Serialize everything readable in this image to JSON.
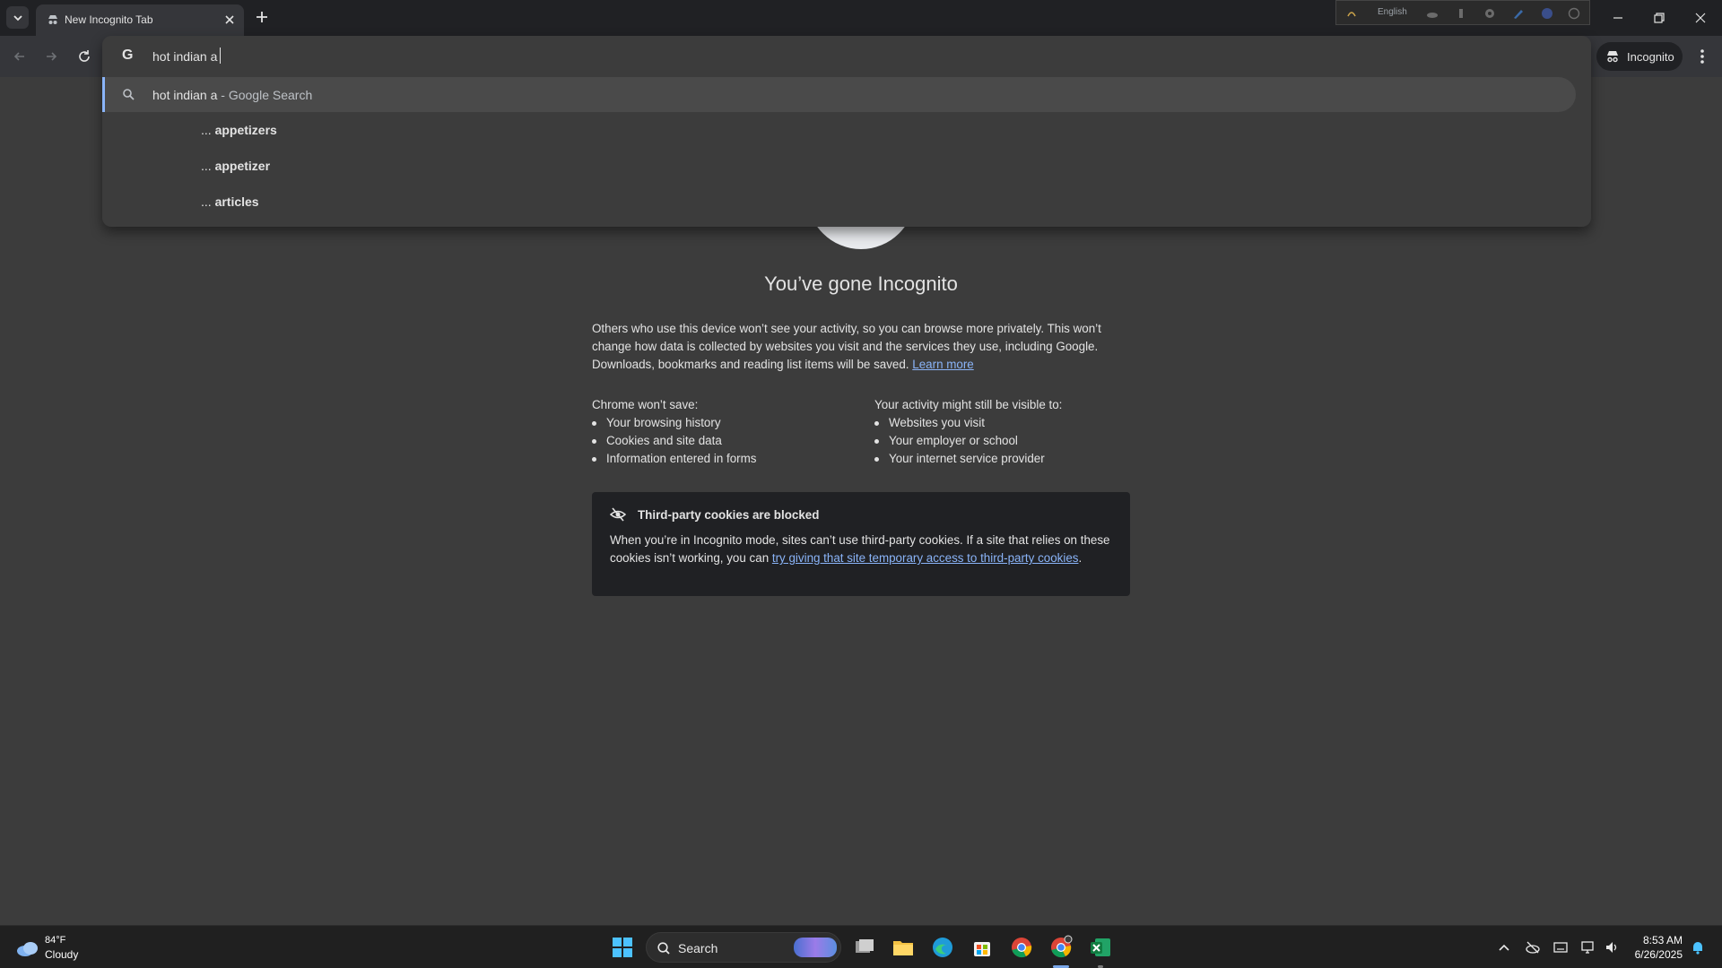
{
  "browser": {
    "tab": {
      "title": "New Incognito Tab"
    },
    "ime": {
      "language": "English"
    },
    "profile_chip": {
      "label": "Incognito"
    }
  },
  "omnibox": {
    "input_value": "hot indian a",
    "top_suggestion": {
      "query": "hot indian a",
      "description": "- Google Search"
    },
    "suggestions": [
      {
        "prefix": "... ",
        "completion": "appetizers"
      },
      {
        "prefix": "... ",
        "completion": "appetizer"
      },
      {
        "prefix": "... ",
        "completion": "articles"
      }
    ]
  },
  "ntp": {
    "title": "You’ve gone Incognito",
    "intro": "Others who use this device won’t see your activity, so you can browse more privately. This won’t change how data is collected by websites you visit and the services they use, including Google. Downloads, bookmarks and reading list items will be saved.",
    "learn_more": "Learn more",
    "wont_save": {
      "heading": "Chrome won’t save:",
      "items": [
        "Your browsing history",
        "Cookies and site data",
        "Information entered in forms"
      ]
    },
    "might_be_visible": {
      "heading": "Your activity might still be visible to:",
      "items": [
        "Websites you visit",
        "Your employer or school",
        "Your internet service provider"
      ]
    },
    "cookies_card": {
      "title": "Third-party cookies are blocked",
      "body": "When you’re in Incognito mode, sites can’t use third-party cookies. If a site that relies on these cookies isn’t working, you can",
      "link": "try giving that site temporary access to third-party cookies",
      "suffix": "."
    }
  },
  "taskbar": {
    "weather": {
      "temp": "84°F",
      "condition": "Cloudy"
    },
    "search_label": "Search",
    "clock": {
      "time": "8:53 AM",
      "date": "6/26/2025"
    }
  },
  "colors": {
    "page_bg": "#3c3c3c",
    "titlebar_bg": "#202124",
    "toolbar_bg": "#35363a",
    "link": "#8ab4f8",
    "taskbar_bg": "#202020"
  }
}
